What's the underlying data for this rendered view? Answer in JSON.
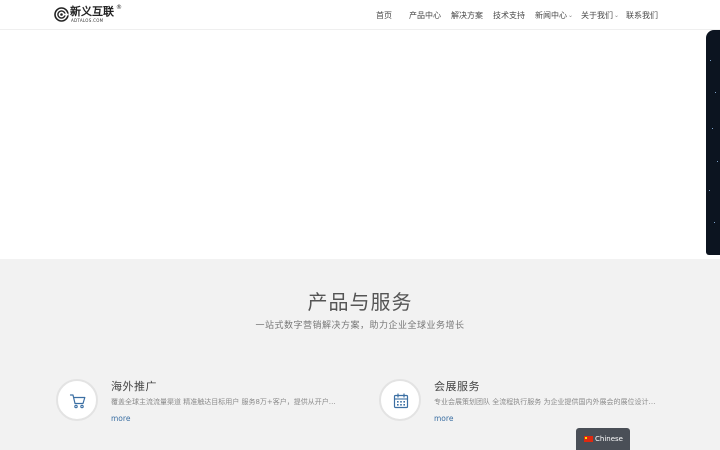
{
  "header": {
    "logo": {
      "name": "新义互联",
      "registered": "®",
      "sub": "ADTALOS.COM"
    },
    "nav": [
      {
        "label": "首页",
        "dropdown": false
      },
      {
        "label": "产品中心",
        "dropdown": false
      },
      {
        "label": "解决方案",
        "dropdown": false
      },
      {
        "label": "技术支持",
        "dropdown": false
      },
      {
        "label": "新闻中心",
        "dropdown": true
      },
      {
        "label": "关于我们",
        "dropdown": true
      },
      {
        "label": "联系我们",
        "dropdown": false
      }
    ]
  },
  "services": {
    "title": "产品与服务",
    "subtitle": "一站式数字营销解决方案，助力企业全球业务增长",
    "cards": [
      {
        "icon": "cart-icon",
        "title": "海外推广",
        "description": "覆盖全球主流流量渠道 精准触达目标用户 服务8万+客户，提供从开户到投放优化的一站式海外营销服务…",
        "more": "more"
      },
      {
        "icon": "calendar-icon",
        "title": "会展服务",
        "description": "专业会展策划团队 全流程执行服务 为企业提供国内外展会的展位设计、搭建及现场运营支持服务…",
        "more": "more"
      }
    ]
  },
  "language": {
    "label": "Chinese",
    "flag": "cn-flag-icon"
  },
  "colors": {
    "accent_link": "#3b6fa3",
    "section_bg": "#f2f2f2",
    "lang_bg": "#4a4f57"
  }
}
